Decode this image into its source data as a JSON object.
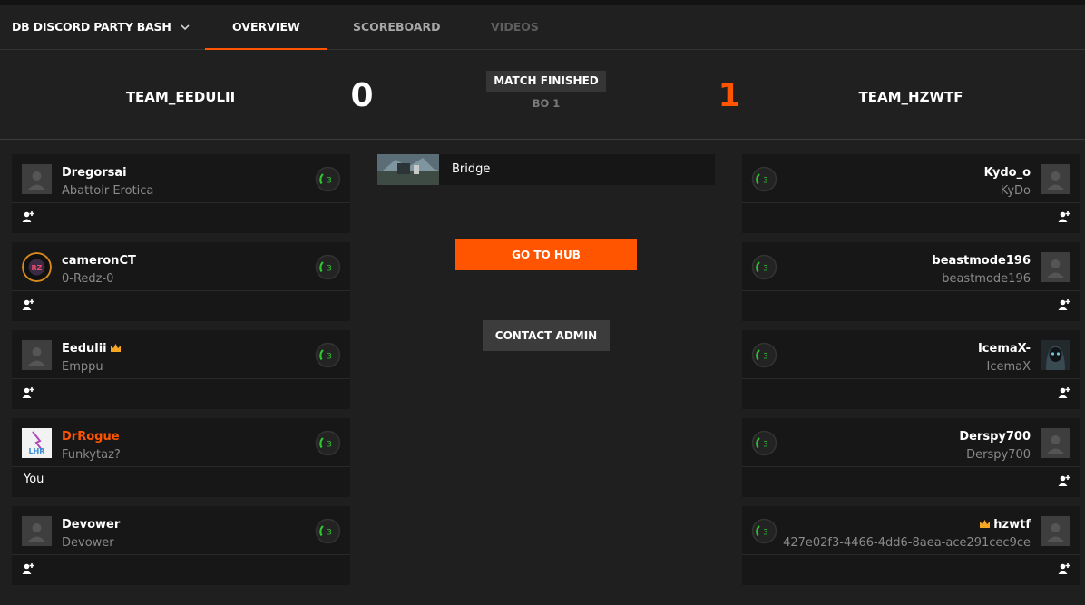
{
  "nav": {
    "title": "DB DISCORD PARTY BASH",
    "tabs": [
      {
        "label": "OVERVIEW"
      },
      {
        "label": "SCOREBOARD"
      },
      {
        "label": "VIDEOS"
      }
    ]
  },
  "match": {
    "team1": {
      "name": "TEAM_EEDULII",
      "score": "0"
    },
    "team2": {
      "name": "TEAM_HZWTF",
      "score": "1"
    },
    "status": "MATCH FINISHED",
    "format": "BO 1"
  },
  "map": {
    "name": "Bridge"
  },
  "actions": {
    "hub": "GO TO HUB",
    "admin": "CONTACT ADMIN"
  },
  "team1_players": [
    {
      "name": "Dregorsai",
      "sub": "Abattoir Erotica",
      "level": "3"
    },
    {
      "name": "cameronCT",
      "sub": "0-Redz-0",
      "level": "3"
    },
    {
      "name": "Eedulii",
      "sub": "Emppu",
      "level": "3",
      "captain": true
    },
    {
      "name": "DrRogue",
      "sub": "Funkytaz?",
      "level": "3",
      "you": "You"
    },
    {
      "name": "Devower",
      "sub": "Devower",
      "level": "3"
    }
  ],
  "team2_players": [
    {
      "name": "Kydo_o",
      "sub": "KyDo",
      "level": "3"
    },
    {
      "name": "beastmode196",
      "sub": "beastmode196",
      "level": "3"
    },
    {
      "name": "IcemaX-",
      "sub": "IcemaX",
      "level": "3"
    },
    {
      "name": "Derspy700",
      "sub": "Derspy700",
      "level": "3"
    },
    {
      "name": "hzwtf",
      "sub": "427e02f3-4466-4dd6-8aea-ace291cec9ce",
      "level": "3",
      "captain": true
    }
  ],
  "colors": {
    "accent": "#ff5500",
    "level_green": "#2ec52e",
    "crown": "#f5a623"
  },
  "icons": {
    "dropdown": "chevron-down-icon",
    "add_friend": "add-friend-icon",
    "level": "skill-level-icon",
    "captain": "crown-icon"
  }
}
